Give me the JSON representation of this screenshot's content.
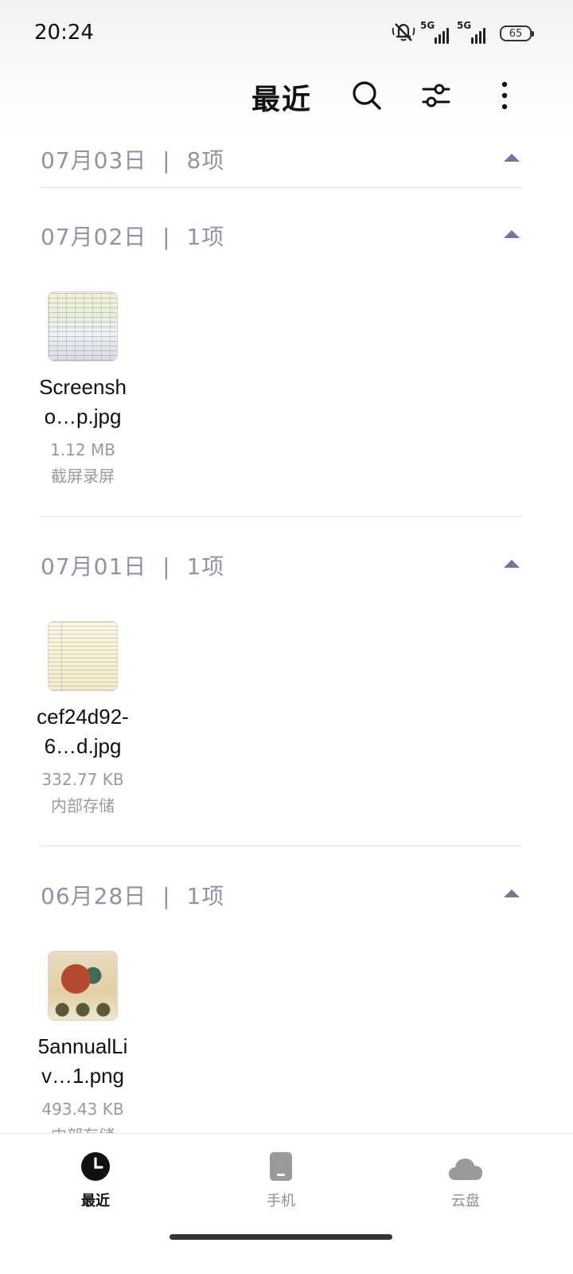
{
  "status_bar": {
    "time": "20:24",
    "network_1": "5G",
    "network_2": "5G",
    "battery": "65",
    "icons": [
      "mute-icon",
      "signal-icon",
      "signal-icon",
      "battery-icon"
    ]
  },
  "header": {
    "title": "最近",
    "icons": [
      "search-icon",
      "filter-icon",
      "more-icon"
    ]
  },
  "groups": [
    {
      "date": "07月03日",
      "separator": "|",
      "count": "8项",
      "files": []
    },
    {
      "date": "07月02日",
      "separator": "|",
      "count": "1项",
      "files": [
        {
          "name": "Screensho…p.jpg",
          "size": "1.12 MB",
          "source": "截屏录屏"
        }
      ]
    },
    {
      "date": "07月01日",
      "separator": "|",
      "count": "1项",
      "files": [
        {
          "name": "cef24d92-6…d.jpg",
          "size": "332.77 KB",
          "source": "内部存储"
        }
      ]
    },
    {
      "date": "06月28日",
      "separator": "|",
      "count": "1项",
      "files": [
        {
          "name": "5annualLiv…1.png",
          "size": "493.43 KB",
          "source": "内部存储"
        }
      ]
    }
  ],
  "bottom_nav": {
    "items": [
      {
        "label": "最近",
        "icon": "clock-icon",
        "active": true
      },
      {
        "label": "手机",
        "icon": "phone-icon",
        "active": false
      },
      {
        "label": "云盘",
        "icon": "cloud-icon",
        "active": false
      }
    ]
  },
  "colors": {
    "group_label": "#8e93a8",
    "arrow": "#6f7896",
    "secondary_text": "#9a9a9a",
    "nav_inactive": "#8f8f8f"
  }
}
